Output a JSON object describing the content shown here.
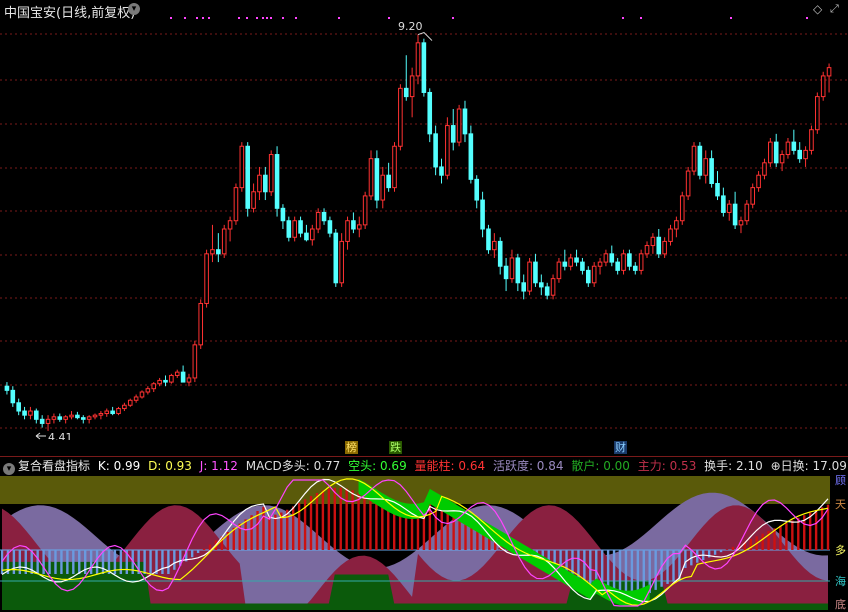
{
  "header": {
    "title": "中国宝安(日线,前复权)"
  },
  "price_chart": {
    "high_label": "9.20",
    "low_label": "4.41",
    "candles": [
      [
        4.95,
        5.0,
        4.85,
        4.9
      ],
      [
        4.9,
        4.95,
        4.7,
        4.75
      ],
      [
        4.75,
        4.8,
        4.6,
        4.65
      ],
      [
        4.65,
        4.7,
        4.55,
        4.6
      ],
      [
        4.6,
        4.7,
        4.55,
        4.65
      ],
      [
        4.65,
        4.68,
        4.5,
        4.55
      ],
      [
        4.55,
        4.6,
        4.45,
        4.5
      ],
      [
        4.5,
        4.6,
        4.41,
        4.55
      ],
      [
        4.55,
        4.62,
        4.5,
        4.58
      ],
      [
        4.58,
        4.62,
        4.52,
        4.55
      ],
      [
        4.55,
        4.6,
        4.5,
        4.58
      ],
      [
        4.58,
        4.65,
        4.55,
        4.6
      ],
      [
        4.6,
        4.64,
        4.55,
        4.57
      ],
      [
        4.57,
        4.6,
        4.5,
        4.55
      ],
      [
        4.55,
        4.6,
        4.5,
        4.58
      ],
      [
        4.58,
        4.62,
        4.55,
        4.6
      ],
      [
        4.6,
        4.65,
        4.55,
        4.62
      ],
      [
        4.62,
        4.68,
        4.58,
        4.65
      ],
      [
        4.65,
        4.7,
        4.6,
        4.62
      ],
      [
        4.62,
        4.7,
        4.6,
        4.68
      ],
      [
        4.68,
        4.75,
        4.65,
        4.72
      ],
      [
        4.72,
        4.8,
        4.7,
        4.78
      ],
      [
        4.78,
        4.85,
        4.75,
        4.82
      ],
      [
        4.82,
        4.9,
        4.8,
        4.88
      ],
      [
        4.88,
        4.95,
        4.85,
        4.92
      ],
      [
        4.92,
        5.0,
        4.88,
        4.98
      ],
      [
        4.98,
        5.05,
        4.95,
        5.02
      ],
      [
        5.02,
        5.08,
        4.95,
        5.0
      ],
      [
        5.0,
        5.1,
        4.98,
        5.08
      ],
      [
        5.08,
        5.15,
        5.05,
        5.12
      ],
      [
        5.12,
        5.2,
        5.08,
        5.0
      ],
      [
        5.0,
        5.1,
        4.95,
        5.05
      ],
      [
        5.05,
        5.5,
        5.0,
        5.45
      ],
      [
        5.45,
        6.0,
        5.4,
        5.95
      ],
      [
        5.95,
        6.6,
        5.9,
        6.55
      ],
      [
        6.55,
        6.9,
        6.45,
        6.6
      ],
      [
        6.6,
        6.8,
        6.45,
        6.55
      ],
      [
        6.55,
        6.9,
        6.5,
        6.85
      ],
      [
        6.85,
        7.0,
        6.7,
        6.95
      ],
      [
        6.95,
        7.4,
        6.9,
        7.35
      ],
      [
        7.35,
        7.9,
        7.3,
        7.85
      ],
      [
        7.85,
        7.9,
        7.0,
        7.1
      ],
      [
        7.1,
        7.4,
        7.05,
        7.3
      ],
      [
        7.3,
        7.6,
        7.2,
        7.5
      ],
      [
        7.5,
        7.6,
        7.2,
        7.3
      ],
      [
        7.3,
        7.8,
        7.25,
        7.75
      ],
      [
        7.75,
        7.85,
        7.0,
        7.1
      ],
      [
        7.1,
        7.15,
        6.85,
        6.95
      ],
      [
        6.95,
        7.0,
        6.7,
        6.75
      ],
      [
        6.75,
        7.0,
        6.7,
        6.95
      ],
      [
        6.95,
        7.0,
        6.75,
        6.8
      ],
      [
        6.8,
        6.9,
        6.7,
        6.72
      ],
      [
        6.72,
        6.9,
        6.65,
        6.85
      ],
      [
        6.85,
        7.1,
        6.8,
        7.05
      ],
      [
        7.05,
        7.1,
        6.9,
        6.95
      ],
      [
        6.95,
        7.0,
        6.75,
        6.8
      ],
      [
        6.8,
        6.85,
        6.15,
        6.2
      ],
      [
        6.2,
        6.8,
        6.15,
        6.7
      ],
      [
        6.7,
        7.0,
        6.6,
        6.95
      ],
      [
        6.95,
        7.05,
        6.8,
        6.85
      ],
      [
        6.85,
        7.0,
        6.75,
        6.9
      ],
      [
        6.9,
        7.3,
        6.85,
        7.25
      ],
      [
        7.25,
        7.8,
        7.2,
        7.7
      ],
      [
        7.7,
        7.8,
        7.1,
        7.2
      ],
      [
        7.2,
        7.6,
        7.1,
        7.5
      ],
      [
        7.5,
        7.65,
        7.3,
        7.35
      ],
      [
        7.35,
        7.9,
        7.3,
        7.85
      ],
      [
        7.85,
        8.6,
        7.8,
        8.55
      ],
      [
        8.55,
        8.95,
        8.4,
        8.45
      ],
      [
        8.45,
        8.8,
        8.2,
        8.7
      ],
      [
        8.7,
        9.2,
        8.6,
        9.1
      ],
      [
        9.1,
        9.15,
        8.45,
        8.5
      ],
      [
        8.5,
        8.55,
        7.9,
        8.0
      ],
      [
        8.0,
        8.1,
        7.5,
        7.6
      ],
      [
        7.6,
        7.7,
        7.4,
        7.5
      ],
      [
        7.5,
        8.2,
        7.45,
        8.1
      ],
      [
        8.1,
        8.3,
        7.8,
        7.9
      ],
      [
        7.9,
        8.35,
        7.85,
        8.3
      ],
      [
        8.3,
        8.4,
        7.9,
        8.0
      ],
      [
        8.0,
        8.1,
        7.4,
        7.45
      ],
      [
        7.45,
        7.5,
        7.1,
        7.2
      ],
      [
        7.2,
        7.3,
        6.75,
        6.85
      ],
      [
        6.85,
        6.9,
        6.55,
        6.6
      ],
      [
        6.6,
        6.8,
        6.5,
        6.7
      ],
      [
        6.7,
        6.75,
        6.3,
        6.4
      ],
      [
        6.4,
        6.5,
        6.1,
        6.25
      ],
      [
        6.25,
        6.6,
        6.2,
        6.5
      ],
      [
        6.5,
        6.55,
        6.1,
        6.2
      ],
      [
        6.2,
        6.3,
        6.0,
        6.1
      ],
      [
        6.1,
        6.5,
        6.05,
        6.45
      ],
      [
        6.45,
        6.55,
        6.15,
        6.2
      ],
      [
        6.2,
        6.3,
        6.05,
        6.15
      ],
      [
        6.15,
        6.2,
        6.0,
        6.05
      ],
      [
        6.05,
        6.3,
        6.0,
        6.25
      ],
      [
        6.25,
        6.5,
        6.2,
        6.45
      ],
      [
        6.45,
        6.6,
        6.35,
        6.4
      ],
      [
        6.4,
        6.55,
        6.35,
        6.5
      ],
      [
        6.5,
        6.6,
        6.4,
        6.45
      ],
      [
        6.45,
        6.5,
        6.3,
        6.35
      ],
      [
        6.35,
        6.4,
        6.15,
        6.2
      ],
      [
        6.2,
        6.45,
        6.15,
        6.4
      ],
      [
        6.4,
        6.5,
        6.3,
        6.45
      ],
      [
        6.45,
        6.6,
        6.4,
        6.55
      ],
      [
        6.55,
        6.65,
        6.4,
        6.45
      ],
      [
        6.45,
        6.5,
        6.3,
        6.35
      ],
      [
        6.35,
        6.6,
        6.3,
        6.55
      ],
      [
        6.55,
        6.6,
        6.35,
        6.4
      ],
      [
        6.4,
        6.45,
        6.3,
        6.35
      ],
      [
        6.35,
        6.6,
        6.3,
        6.55
      ],
      [
        6.55,
        6.7,
        6.5,
        6.65
      ],
      [
        6.65,
        6.8,
        6.55,
        6.75
      ],
      [
        6.75,
        6.85,
        6.5,
        6.55
      ],
      [
        6.55,
        6.75,
        6.5,
        6.7
      ],
      [
        6.7,
        6.9,
        6.65,
        6.85
      ],
      [
        6.85,
        7.0,
        6.75,
        6.95
      ],
      [
        6.95,
        7.3,
        6.9,
        7.25
      ],
      [
        7.25,
        7.6,
        7.2,
        7.55
      ],
      [
        7.55,
        7.9,
        7.5,
        7.85
      ],
      [
        7.85,
        7.9,
        7.45,
        7.5
      ],
      [
        7.5,
        7.8,
        7.4,
        7.7
      ],
      [
        7.7,
        7.8,
        7.35,
        7.4
      ],
      [
        7.4,
        7.55,
        7.2,
        7.25
      ],
      [
        7.25,
        7.35,
        7.0,
        7.05
      ],
      [
        7.05,
        7.2,
        6.95,
        7.15
      ],
      [
        7.15,
        7.3,
        6.85,
        6.9
      ],
      [
        6.9,
        7.0,
        6.8,
        6.95
      ],
      [
        6.95,
        7.2,
        6.9,
        7.15
      ],
      [
        7.15,
        7.4,
        7.1,
        7.35
      ],
      [
        7.35,
        7.55,
        7.3,
        7.5
      ],
      [
        7.5,
        7.7,
        7.45,
        7.65
      ],
      [
        7.65,
        7.95,
        7.6,
        7.9
      ],
      [
        7.9,
        8.0,
        7.6,
        7.65
      ],
      [
        7.65,
        7.8,
        7.55,
        7.75
      ],
      [
        7.75,
        7.95,
        7.7,
        7.9
      ],
      [
        7.9,
        8.05,
        7.75,
        7.8
      ],
      [
        7.8,
        7.9,
        7.65,
        7.7
      ],
      [
        7.7,
        7.85,
        7.6,
        7.8
      ],
      [
        7.8,
        8.1,
        7.75,
        8.05
      ],
      [
        8.05,
        8.5,
        8.0,
        8.45
      ],
      [
        8.45,
        8.75,
        8.4,
        8.7
      ],
      [
        8.7,
        8.85,
        8.5,
        8.8
      ]
    ]
  },
  "markers": {
    "bang": "榜",
    "die": "跌",
    "cai": "财"
  },
  "indicator": {
    "name": "复合看盘指标",
    "k_label": "K: 0.99",
    "d_label": "D: 0.93",
    "j_label": "J: 1.12",
    "macd_bull": "MACD多头: 0.77",
    "bear": "空头: 0.69",
    "volume_col": "量能柱: 0.64",
    "activity": "活跃度: 0.84",
    "retail": "散户: 0.00",
    "main_force": "主力: 0.53",
    "turnover": "换手: 2.10",
    "day_turnover": "日换: 17.09",
    "day_turnover_prefix": "⊕",
    "side_labels": [
      "顾",
      "天",
      "多",
      "海",
      "底"
    ]
  },
  "colors": {
    "up": "#ff3232",
    "down": "#54ffff",
    "grid": "#7a1a1a",
    "k": "#ffffff",
    "d": "#ffff00",
    "j": "#ff44ff",
    "bull": "#00cc00",
    "bear_band": "#ff3030",
    "volume": "#cc1111",
    "activity_fill": "#7a6aa0",
    "retail_fill": "#0b5a0b",
    "main_fill": "#8a2040",
    "top_band": "#5a5a0a"
  }
}
